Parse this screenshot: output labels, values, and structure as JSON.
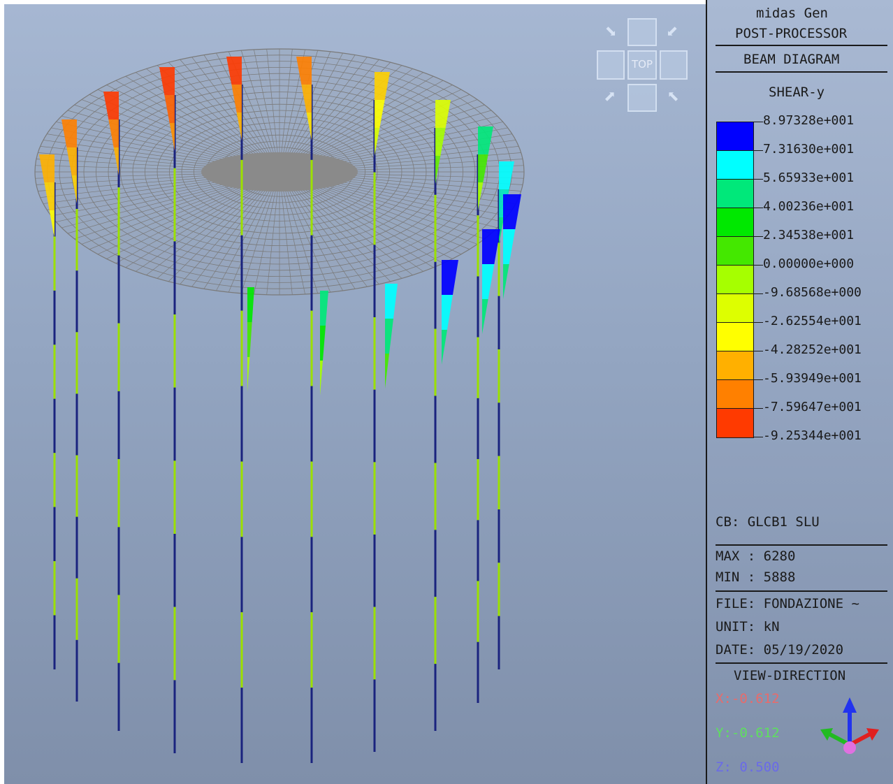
{
  "app": {
    "name": "midas Gen",
    "module": "POST-PROCESSOR",
    "diagram_type": "BEAM DIAGRAM",
    "component": "SHEAR-y"
  },
  "view_cube": {
    "label": "TOP"
  },
  "legend": {
    "values": [
      "8.97328e+001",
      "7.31630e+001",
      "5.65933e+001",
      "4.00236e+001",
      "2.34538e+001",
      "0.00000e+000",
      "-9.68568e+000",
      "-2.62554e+001",
      "-4.28252e+001",
      "-5.93949e+001",
      "-7.59647e+001",
      "-9.25344e+001"
    ],
    "colors": [
      "#0000ff",
      "#00ffff",
      "#00e87a",
      "#00e800",
      "#44e800",
      "#a6ff00",
      "#ddff00",
      "#ffff00",
      "#ffb000",
      "#ff8000",
      "#ff3a00"
    ]
  },
  "info": {
    "cb": "CB: GLCB1 SLU",
    "max": "MAX : 6280",
    "min": "MIN : 5888",
    "file": "FILE: FONDAZIONE ~",
    "unit": "UNIT: kN",
    "date": "DATE: 05/19/2020"
  },
  "view_direction": {
    "title": "VIEW-DIRECTION",
    "x": "X:-0.612",
    "y": "Y:-0.612",
    "z": "Z: 0.500",
    "x_color": "#e86b6b",
    "y_color": "#5ee05e",
    "z_color": "#6a6ae8"
  },
  "colors": {
    "mesh": "#7a7a7a",
    "pile_dark": "#1a237e",
    "pile_green": "#9be000"
  }
}
